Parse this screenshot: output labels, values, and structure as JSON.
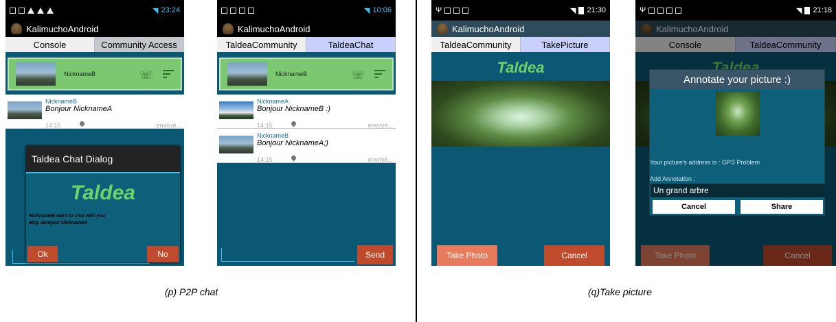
{
  "p1": {
    "status_time": "23:24",
    "app_title": "KalimuchoAndroid",
    "tabs": [
      "Console",
      "Community Access"
    ],
    "contact_name": "NicknameB",
    "messages": [
      {
        "name": "NicknameB",
        "text": "Bonjour NicknameA",
        "time": "14:15",
        "status": "envoyé..."
      }
    ],
    "dialog_title": "Taldea Chat Dialog",
    "dialog_brand": "Taldea",
    "dialog_line1": "NicknameB want to chat with you",
    "dialog_line2": "Msg :Bonjour NicknameA",
    "ok_label": "Ok",
    "no_label": "No",
    "behind_d": "d"
  },
  "p2": {
    "status_time": "10:06",
    "app_title": "KalimuchoAndroid",
    "tabs": [
      "TaldeaCommunity",
      "TaldeaChat"
    ],
    "contact_name": "NicknameB",
    "messages": [
      {
        "name": "NicknameA",
        "text": "Bonjour NicknameB :)",
        "time": "14:15",
        "status": "envoyé..."
      },
      {
        "name": "NicknameB",
        "text": "Bonjour NicknameA;)",
        "time": "14:15",
        "status": "envoyé..."
      }
    ],
    "send_label": "Send"
  },
  "p3": {
    "status_time": "21:30",
    "app_title": "KalimuchoAndroid",
    "tabs": [
      "TaldeaCommunity",
      "TakePicture"
    ],
    "brand": "Taldea",
    "take_photo": "Take Photo",
    "cancel": "Cancel"
  },
  "p4": {
    "status_time": "21:18",
    "app_title": "KalimuchoAndroid",
    "tabs": [
      "Console",
      "TaldeaCommunity"
    ],
    "brand": "Taldea",
    "dialog_title": "Annotate your picture :)",
    "address_text": "Your picture's address is : GPS Problem",
    "add_annotation": "Add Annotation :",
    "annotation_value": "Un grand arbre",
    "cancel_btn": "Cancel",
    "share_btn": "Share",
    "take_photo": "Take Photo",
    "cancel": "Cancel"
  },
  "captions": {
    "left": "(p) P2P chat",
    "right": "(q)Take picture"
  },
  "colors": {
    "screen_bg": "#0a5874",
    "accent_green": "#7ac870",
    "button_red": "#c04a2c",
    "status_blue": "#3fc1f1",
    "tab_active": "#c9cffb"
  }
}
